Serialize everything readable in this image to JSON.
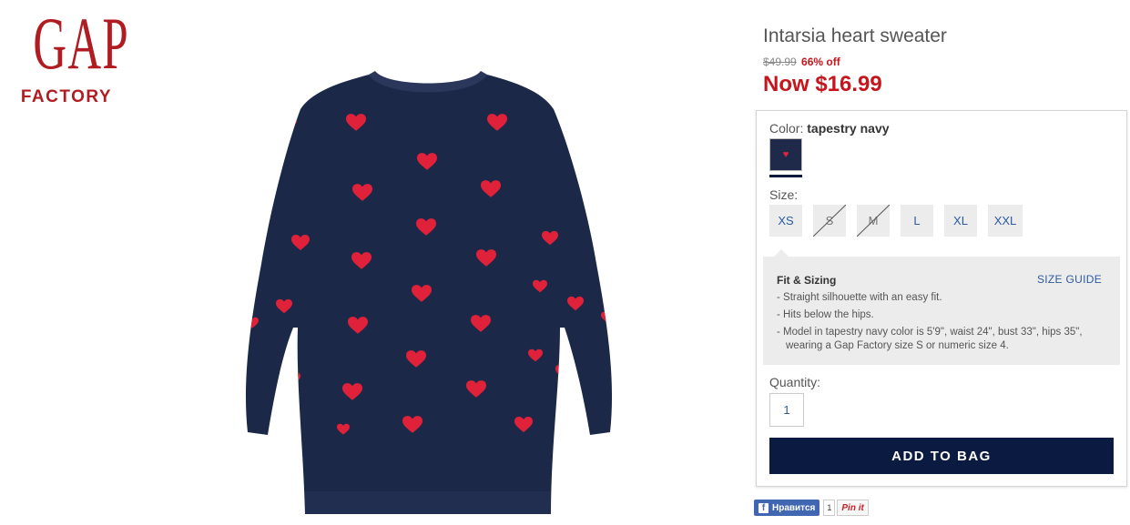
{
  "brand": {
    "logo_top": "GAP",
    "logo_bottom": "FACTORY",
    "color": "#b01c22"
  },
  "product": {
    "title": "Intarsia heart sweater",
    "original_price": "$49.99",
    "discount": "66% off",
    "now_price": "Now $16.99",
    "image": "navy sweater with red hearts"
  },
  "options": {
    "color_label": "Color:",
    "color_value": "tapestry navy",
    "swatch_color": "#1f2a4a",
    "size_label": "Size:",
    "sizes": [
      {
        "label": "XS",
        "available": true
      },
      {
        "label": "S",
        "available": false
      },
      {
        "label": "M",
        "available": false
      },
      {
        "label": "L",
        "available": true
      },
      {
        "label": "XL",
        "available": true
      },
      {
        "label": "XXL",
        "available": true
      }
    ]
  },
  "fit": {
    "title": "Fit & Sizing",
    "size_guide": "SIZE GUIDE",
    "items": [
      "- Straight silhouette with an easy fit.",
      "- Hits below the hips.",
      "- Model in tapestry navy color is 5'9\", waist 24\", bust 33\", hips 35\", wearing a Gap Factory size S or numeric size 4."
    ]
  },
  "quantity": {
    "label": "Quantity:",
    "value": "1"
  },
  "add_to_bag": "ADD TO BAG",
  "social": {
    "fb_icon": "f",
    "fb_like": "Нравится",
    "fb_count": "1",
    "pin": "Pin it"
  },
  "colors": {
    "sale_red": "#c4161c",
    "link_blue": "#2b5aa0",
    "button_navy": "#0b1a40"
  }
}
